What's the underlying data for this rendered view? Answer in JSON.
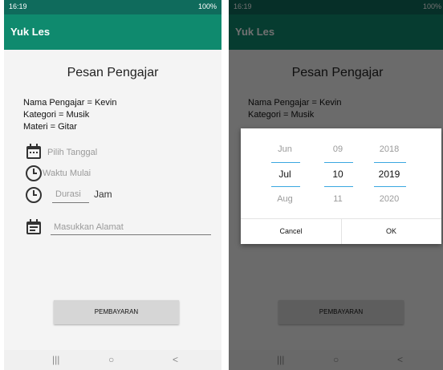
{
  "status_bar": {
    "time": "16:19",
    "icons": "100%"
  },
  "app": {
    "title": "Yuk Les"
  },
  "page": {
    "title": "Pesan Pengajar"
  },
  "info": {
    "pengajar": "Nama Pengajar = Kevin",
    "kategori": "Kategori = Musik",
    "materi": "Materi = Gitar"
  },
  "form": {
    "date_placeholder": "Pilih Tanggal",
    "start_time_placeholder": "Waktu Mulai",
    "duration_placeholder": "Durasi",
    "duration_unit": "Jam",
    "address_placeholder": "Masukkan Alamat"
  },
  "button": {
    "pay_label": "PEMBAYARAN"
  },
  "nav": {
    "recents": "|||",
    "home": "○",
    "back": "<"
  },
  "date_picker": {
    "months": [
      "Jun",
      "Jul",
      "Aug"
    ],
    "days": [
      "09",
      "10",
      "11"
    ],
    "years": [
      "2018",
      "2019",
      "2020"
    ],
    "cancel_label": "Cancel",
    "ok_label": "OK"
  },
  "colors": {
    "status_bar": "#0f6b5c",
    "app_bar": "#0f8a6e",
    "picker_accent": "#3aa7e0"
  },
  "icons": [
    "calendar-icon",
    "clock-icon",
    "clock-icon",
    "calendar-icon",
    "wifi-icon",
    "battery-icon"
  ]
}
